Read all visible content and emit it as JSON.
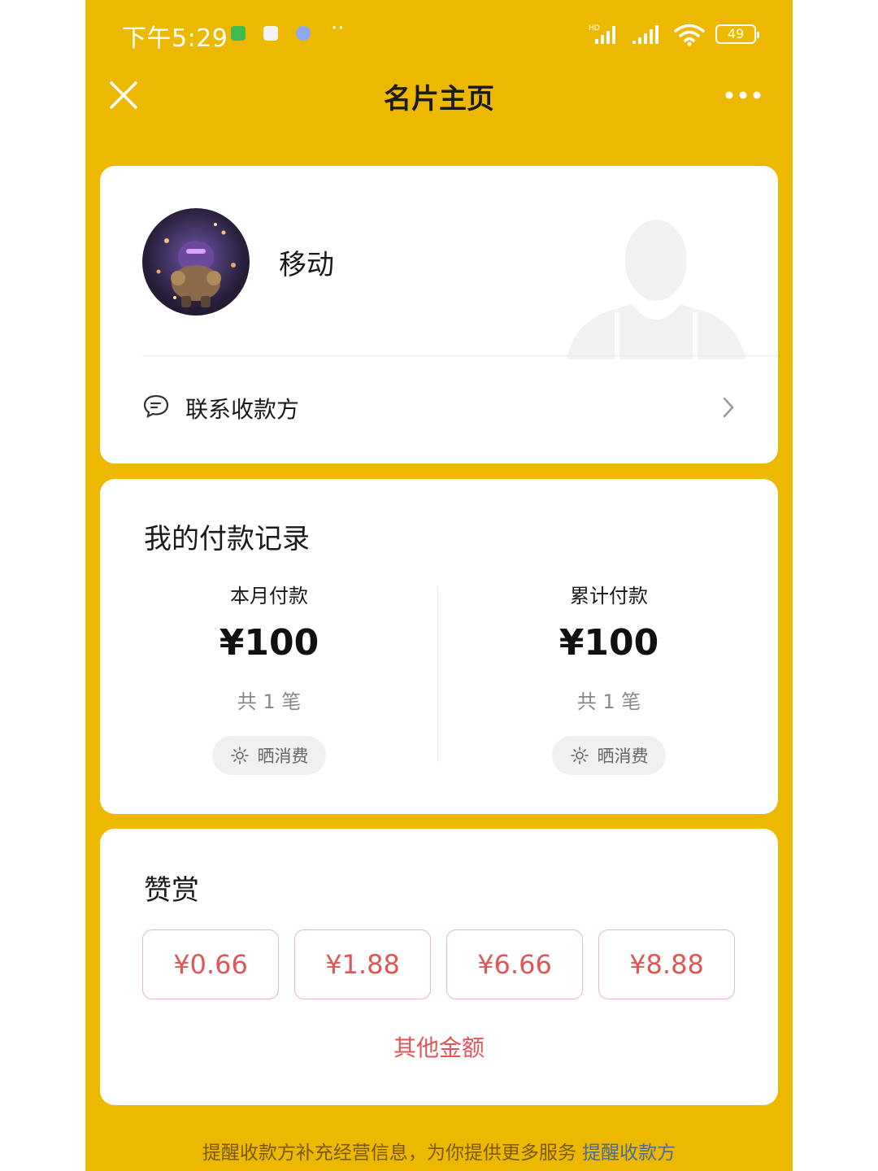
{
  "status_bar": {
    "time": "下午5:29",
    "notification_dots": "··",
    "battery": "49"
  },
  "nav": {
    "title": "名片主页"
  },
  "profile": {
    "name": "移动",
    "contact_label": "联系收款方"
  },
  "payment_record": {
    "title": "我的付款记录",
    "monthly": {
      "label": "本月付款",
      "amount": "¥100",
      "count": "共 1 笔",
      "share_label": "晒消费"
    },
    "total": {
      "label": "累计付款",
      "amount": "¥100",
      "count": "共 1 笔",
      "share_label": "晒消费"
    }
  },
  "tip": {
    "title": "赞赏",
    "amounts": [
      "¥0.66",
      "¥1.88",
      "¥6.66",
      "¥8.88"
    ],
    "other_label": "其他金额"
  },
  "footer": {
    "text": "提醒收款方补充经营信息，为你提供更多服务",
    "link": "提醒收款方"
  },
  "colors": {
    "background": "#EDB800",
    "accent_red": "#E05656",
    "link_blue": "#4A6A9A"
  }
}
